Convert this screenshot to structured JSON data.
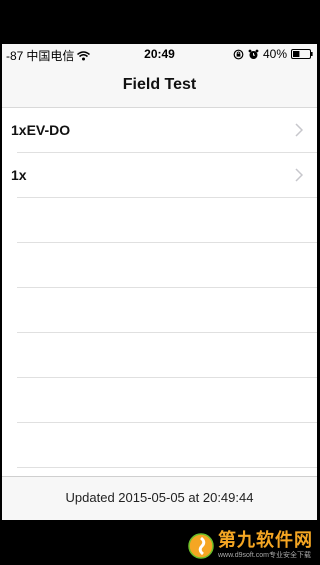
{
  "status_bar": {
    "signal": "-87",
    "carrier": "中国电信",
    "time": "20:49",
    "battery": "40%"
  },
  "nav": {
    "title": "Field Test"
  },
  "list": {
    "items": [
      {
        "label": "1xEV-DO"
      },
      {
        "label": "1x"
      }
    ]
  },
  "toolbar": {
    "updated_text": "Updated 2015-05-05 at 20:49:44"
  },
  "watermark": {
    "title": "第九软件网",
    "subtitle": "www.d9soft.com专业安全下载"
  },
  "colors": {
    "bar_bg": "#f7f7f7",
    "separator": "#e0e0e0",
    "chevron": "#c7c7cc",
    "watermark_accent": "#f5a623"
  }
}
